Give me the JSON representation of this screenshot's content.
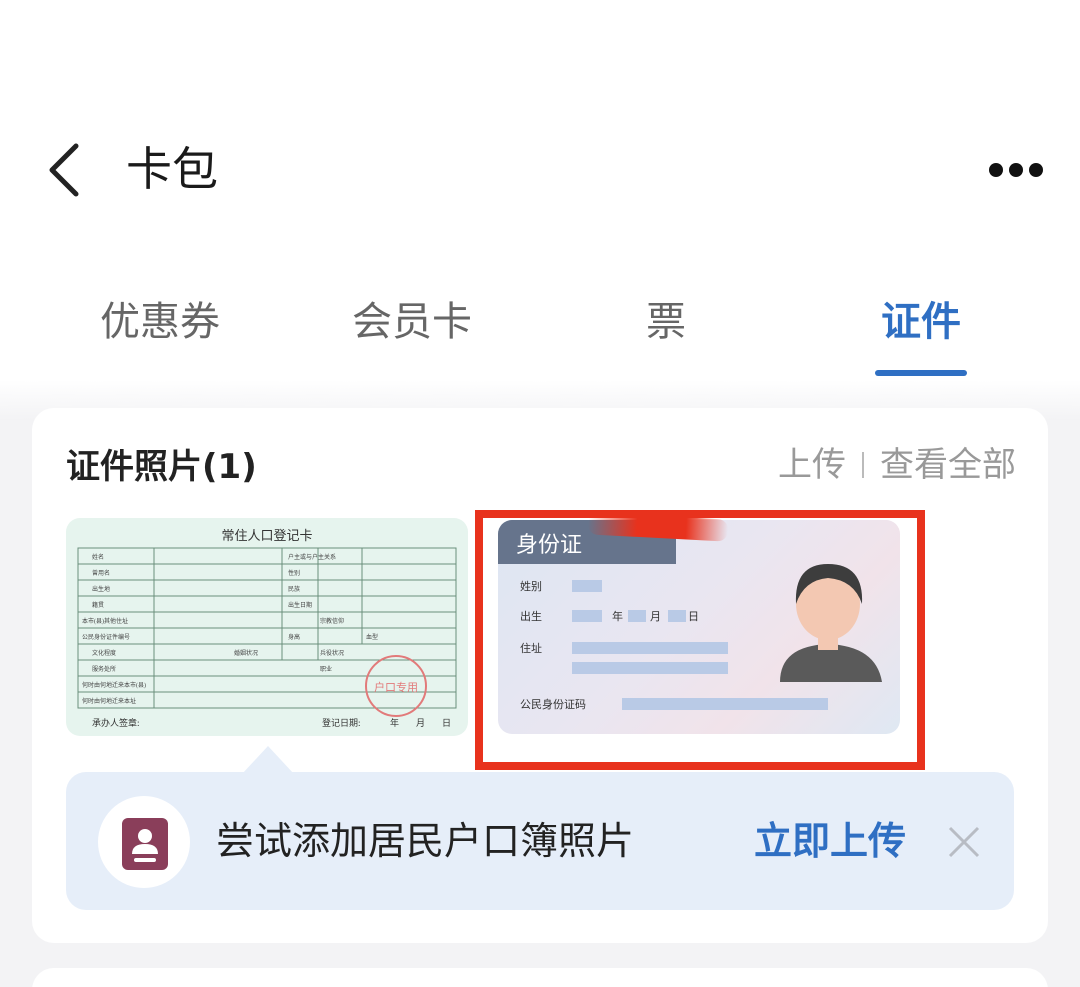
{
  "header": {
    "title": "卡包",
    "back_icon": "chevron-left-icon",
    "more_icon": "ellipsis-icon"
  },
  "tabs": [
    {
      "label": "优惠券",
      "active": false
    },
    {
      "label": "会员卡",
      "active": false
    },
    {
      "label": "票",
      "active": false
    },
    {
      "label": "证件",
      "active": true
    }
  ],
  "photos_section": {
    "title": "证件照片(1)",
    "upload_label": "上传",
    "view_all_label": "查看全部",
    "hukou_card": {
      "title": "常住人口登记卡",
      "fields": [
        "姓名",
        "户主或与户主关系",
        "曾用名",
        "性别",
        "出生地",
        "民族",
        "籍贯",
        "出生日期",
        "本市(县)其他住址",
        "宗教信仰",
        "公民身份证件编号",
        "身高",
        "血型",
        "文化程度",
        "婚姻状况",
        "兵役状况",
        "服务处所",
        "职业",
        "何时由何地迁来本市(县)",
        "何时由何地迁来本址"
      ],
      "signature_label": "承办人签章:",
      "date_label": "登记日期:",
      "year": "年",
      "month": "月",
      "day": "日",
      "stamp_text": "户口专用"
    },
    "id_card": {
      "label": "身份证",
      "gender_label": "姓别",
      "birth_label": "出生",
      "year": "年",
      "month": "月",
      "day": "日",
      "address_label": "住址",
      "id_number_label": "公民身份证码",
      "avatar_icon": "person-avatar-icon"
    }
  },
  "hint": {
    "icon": "household-register-icon",
    "text": "尝试添加居民户口簿照片",
    "action_label": "立即上传",
    "close_icon": "close-icon"
  },
  "colors": {
    "accent": "#2f6fc3",
    "highlight": "#e8321d",
    "hint_bg": "#e6eef9",
    "hukou_bg": "#e6f4ee"
  }
}
